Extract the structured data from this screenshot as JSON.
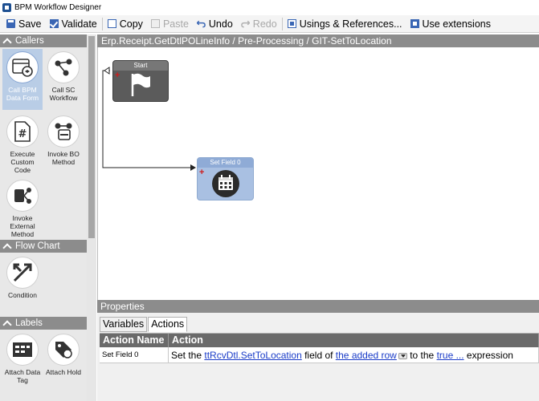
{
  "window": {
    "title": "BPM Workflow Designer"
  },
  "toolbar": {
    "save": "Save",
    "validate": "Validate",
    "copy": "Copy",
    "paste": "Paste",
    "undo": "Undo",
    "redo": "Redo",
    "usings": "Usings & References...",
    "use_extensions": "Use extensions"
  },
  "palette": {
    "callers": {
      "title": "Callers",
      "items": [
        {
          "label": "Call BPM Data Form",
          "icon": "data-form-icon",
          "selected": true
        },
        {
          "label": "Call SC Workflow",
          "icon": "workflow-icon",
          "selected": false
        },
        {
          "label": "Execute Custom Code",
          "icon": "custom-code-icon",
          "selected": false
        },
        {
          "label": "Invoke BO Method",
          "icon": "bo-method-icon",
          "selected": false
        },
        {
          "label": "Invoke External Method",
          "icon": "external-method-icon",
          "selected": false
        }
      ]
    },
    "flow_chart": {
      "title": "Flow Chart",
      "items": [
        {
          "label": "Condition",
          "icon": "condition-icon"
        }
      ]
    },
    "labels": {
      "title": "Labels",
      "items": [
        {
          "label": "Attach Data Tag",
          "icon": "data-tag-icon"
        },
        {
          "label": "Attach Hold",
          "icon": "hold-icon"
        }
      ]
    }
  },
  "canvas": {
    "breadcrumb": "Erp.Receipt.GetDtlPOLineInfo / Pre-Processing / GIT-SetToLocation",
    "nodes": [
      {
        "title": "Start",
        "icon": "flag-icon"
      },
      {
        "title": "Set Field 0",
        "icon": "calendar-icon"
      }
    ]
  },
  "properties": {
    "title": "Properties",
    "tabs": [
      {
        "label": "Variables",
        "active": false
      },
      {
        "label": "Actions",
        "active": true
      }
    ],
    "columns": [
      "Action Name",
      "Action"
    ],
    "rows": [
      {
        "name": "Set Field 0",
        "text_1": "Set the ",
        "link_1": "ttRcvDtl.SetToLocation",
        "text_2": " field of ",
        "link_2": "the added row",
        "text_3": " to the ",
        "link_3": " true ...",
        "text_4": " expression"
      }
    ]
  },
  "colors": {
    "accent": "#3a66b4",
    "header": "#8c8c8c",
    "selected": "#b9cde6",
    "link": "#1a3cc8",
    "node_blue": "#a9c0e2"
  }
}
